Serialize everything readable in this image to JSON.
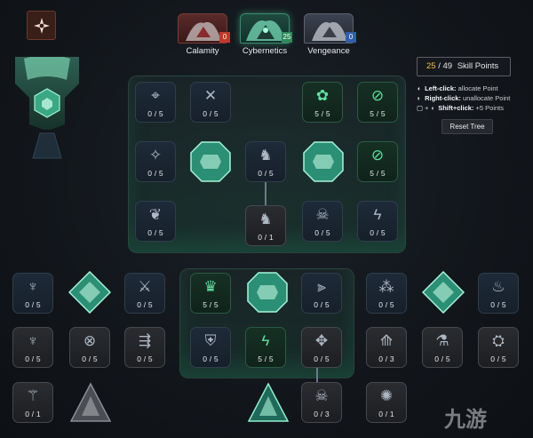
{
  "branches": [
    {
      "name": "Calamity",
      "points": "0",
      "badge_color": "#c0392b"
    },
    {
      "name": "Cybernetics",
      "points": "25",
      "badge_color": "#2e8b57"
    },
    {
      "name": "Vengeance",
      "points": "0",
      "badge_color": "#2f5fa8"
    }
  ],
  "skill_points": {
    "current": "25",
    "total": "/ 49",
    "label": "Skill Points"
  },
  "help": [
    {
      "key": "Left-click:",
      "text": " allocate Point"
    },
    {
      "key": "Right-click:",
      "text": " unallocate Point"
    },
    {
      "key": "Shift+click:",
      "text": " +5 Points"
    }
  ],
  "reset_label": "Reset Tree",
  "watermark": "九游",
  "nodes": [
    {
      "name": "node-1",
      "level": "0 / 5",
      "icon": "⌖",
      "style": "blue"
    },
    {
      "name": "node-2",
      "level": "0 / 5",
      "icon": "✕",
      "style": "blue"
    },
    {
      "name": "node-3",
      "level": "5 / 5",
      "icon": "✿",
      "style": "green"
    },
    {
      "name": "node-4",
      "level": "5 / 5",
      "icon": "⊘",
      "style": "green"
    },
    {
      "name": "node-5",
      "level": "0 / 5",
      "icon": "✧",
      "style": "blue"
    },
    {
      "name": "node-6",
      "level": "0 / 5",
      "icon": "♞",
      "style": "blue"
    },
    {
      "name": "node-7",
      "level": "5 / 5",
      "icon": "⊘",
      "style": "green"
    },
    {
      "name": "node-8",
      "level": "0 / 5",
      "icon": "❦",
      "style": "blue"
    },
    {
      "name": "node-9",
      "level": "0 / 1",
      "icon": "♞",
      "style": "gray"
    },
    {
      "name": "node-10",
      "level": "0 / 5",
      "icon": "☠",
      "style": "blue"
    },
    {
      "name": "node-11",
      "level": "0 / 5",
      "icon": "ϟ",
      "style": "blue"
    },
    {
      "name": "node-12",
      "level": "0 / 5",
      "icon": "♆",
      "style": "blue"
    },
    {
      "name": "node-13",
      "level": "0 / 5",
      "icon": "⚔",
      "style": "blue"
    },
    {
      "name": "node-14",
      "level": "5 / 5",
      "icon": "♛",
      "style": "green"
    },
    {
      "name": "node-15",
      "level": "0 / 5",
      "icon": "⫸",
      "style": "blue"
    },
    {
      "name": "node-16",
      "level": "0 / 5",
      "icon": "⁂",
      "style": "blue"
    },
    {
      "name": "node-17",
      "level": "0 / 5",
      "icon": "♨",
      "style": "blue"
    },
    {
      "name": "node-18",
      "level": "0 / 5",
      "icon": "♆",
      "style": "gray"
    },
    {
      "name": "node-19",
      "level": "0 / 5",
      "icon": "⊗",
      "style": "gray"
    },
    {
      "name": "node-20",
      "level": "0 / 5",
      "icon": "⇶",
      "style": "gray"
    },
    {
      "name": "node-21",
      "level": "0 / 5",
      "icon": "⛨",
      "style": "blue"
    },
    {
      "name": "node-22",
      "level": "5 / 5",
      "icon": "ϟ",
      "style": "green"
    },
    {
      "name": "node-23",
      "level": "0 / 5",
      "icon": "✥",
      "style": "gray"
    },
    {
      "name": "node-24",
      "level": "0 / 3",
      "icon": "⟰",
      "style": "gray"
    },
    {
      "name": "node-25",
      "level": "0 / 5",
      "icon": "⚗",
      "style": "gray"
    },
    {
      "name": "node-26",
      "level": "0 / 5",
      "icon": "⛭",
      "style": "gray"
    },
    {
      "name": "node-27",
      "level": "0 / 1",
      "icon": "⚚",
      "style": "gray"
    },
    {
      "name": "node-28",
      "level": "0 / 3",
      "icon": "☠",
      "style": "gray"
    },
    {
      "name": "node-29",
      "level": "0 / 1",
      "icon": "✺",
      "style": "gray"
    }
  ]
}
